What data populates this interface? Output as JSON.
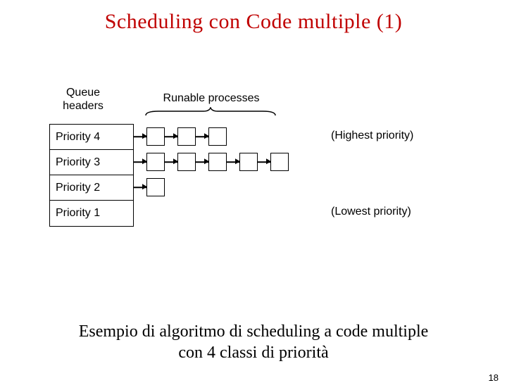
{
  "title": "Scheduling con Code multiple (1)",
  "diagram": {
    "queue_header_label_l1": "Queue",
    "queue_header_label_l2": "headers",
    "runable_label": "Runable processes",
    "rows": [
      {
        "label": "Priority 4",
        "side": "(Highest priority)"
      },
      {
        "label": "Priority 3",
        "side": ""
      },
      {
        "label": "Priority 2",
        "side": ""
      },
      {
        "label": "Priority 1",
        "side": "(Lowest priority)"
      }
    ]
  },
  "chart_data": {
    "type": "table",
    "description": "Multiple-queue scheduling, 4 priority classes",
    "rows": [
      {
        "priority": 4,
        "processes_in_queue": 3,
        "note": "Highest priority"
      },
      {
        "priority": 3,
        "processes_in_queue": 5,
        "note": ""
      },
      {
        "priority": 2,
        "processes_in_queue": 1,
        "note": ""
      },
      {
        "priority": 1,
        "processes_in_queue": 0,
        "note": "Lowest priority"
      }
    ]
  },
  "caption_l1": "Esempio di algoritmo di scheduling a code multiple",
  "caption_l2": "con 4 classi di priorità",
  "page_number": "18"
}
